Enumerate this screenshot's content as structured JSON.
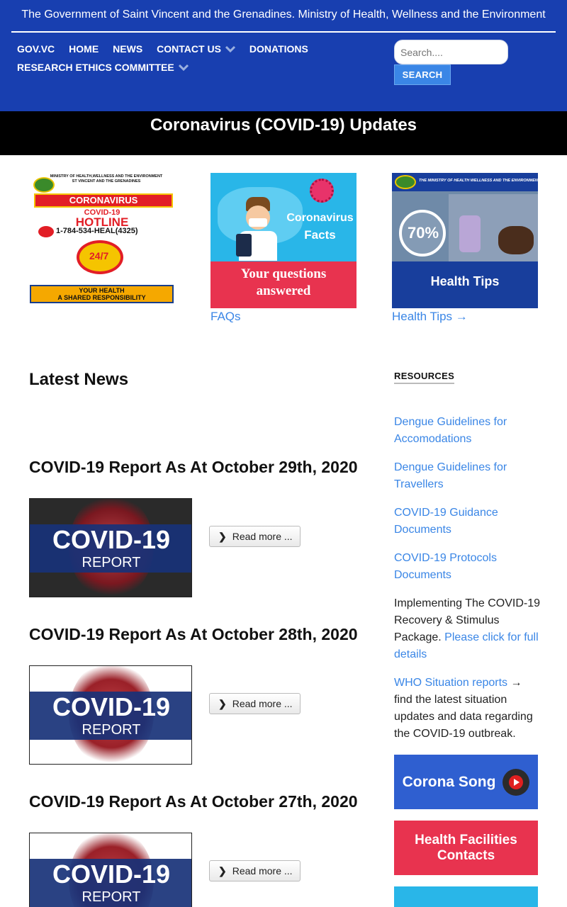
{
  "header": {
    "site_title": "The Government of Saint Vincent and the Grenadines. Ministry of Health, Wellness and the Environment",
    "nav_row1": [
      "GOV.VC",
      "HOME",
      "NEWS",
      "CONTACT US",
      "DONATIONS"
    ],
    "nav_row2": [
      "RESEARCH ETHICS COMMITTEE"
    ],
    "search_placeholder": "Search....",
    "search_button": "SEARCH",
    "colors": {
      "header_bg": "#183fb0",
      "link": "#3a86e6"
    }
  },
  "banner": {
    "title": "Coronavirus (COVID-19) Updates"
  },
  "cards": {
    "hotline": {
      "line1": "MINISTRY OF HEALTH,WELLNESS AND THE ENVIRONMENT",
      "line2": "ST VINCENT AND THE GRENADINES",
      "label": "CORONAVIRUS",
      "sub": "COVID-19",
      "hotline": "HOTLINE",
      "phone": "1-784-534-HEAL(4325)",
      "hours": "24/7",
      "footer1": "YOUR HEALTH",
      "footer2": "A SHARED RESPONSIBILITY"
    },
    "facts": {
      "title1": "Coronavirus",
      "title2": "Facts",
      "bottom1": "Your questions",
      "bottom2": "answered",
      "link": "FAQs"
    },
    "tips": {
      "top": "THE MINISTRY OF HEALTH WELLNESS AND THE ENVIRONMENT",
      "percent": "70%",
      "bottom": "Health Tips",
      "link": "Health Tips →"
    }
  },
  "news": {
    "heading": "Latest News",
    "thumb_title": "COVID-19",
    "thumb_sub": "REPORT",
    "read_more": "Read more ...",
    "posts": [
      {
        "title": "COVID-19 Report As At October 29th, 2020"
      },
      {
        "title": "COVID-19 Report As At October 28th, 2020"
      },
      {
        "title": "COVID-19 Report As At October 27th, 2020"
      }
    ]
  },
  "sidebar": {
    "heading": "RESOURCES",
    "links": [
      "Dengue Guidelines for Accomodations",
      "Dengue Guidelines for Travellers",
      "COVID-19 Guidance Documents",
      "COVID-19 Protocols Documents"
    ],
    "stimulus_text": "Implementing The COVID-19 Recovery & Stimulus Package.",
    "stimulus_link": "Please click for full details",
    "who_link": "WHO Situation reports",
    "who_text": "→ find the latest situation updates and data regarding the COVID-19 outbreak.",
    "banners": [
      "Corona Song",
      "Health Facilities Contacts"
    ]
  }
}
